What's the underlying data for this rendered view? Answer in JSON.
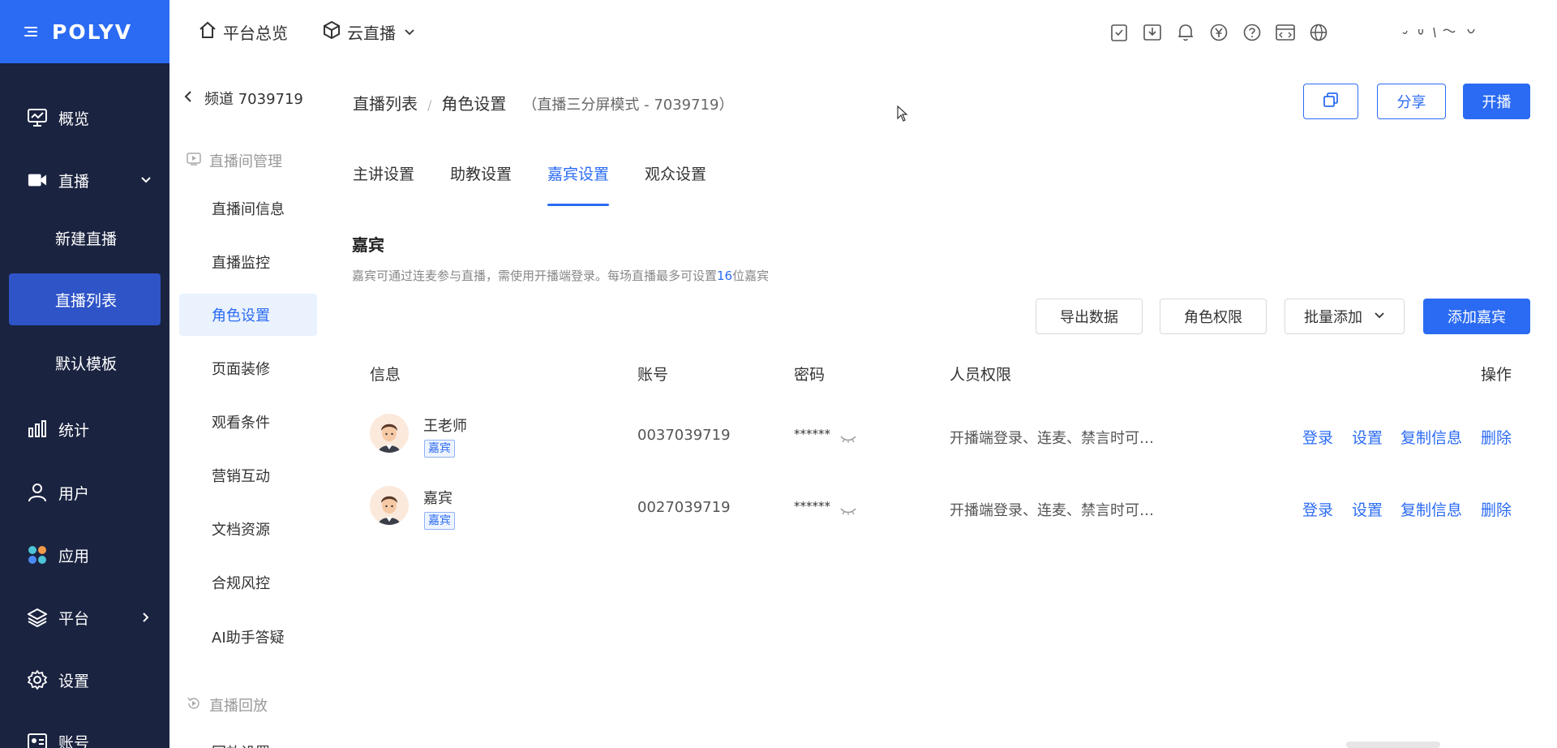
{
  "brand": {
    "logo": "POLYV"
  },
  "leftnav": {
    "items": [
      {
        "label": "概览",
        "icon": "monitor-chart-icon"
      },
      {
        "label": "直播",
        "icon": "video-camera-icon"
      },
      {
        "label": "统计",
        "icon": "bar-chart-icon"
      },
      {
        "label": "用户",
        "icon": "user-icon"
      },
      {
        "label": "应用",
        "icon": "apps-grid-icon"
      },
      {
        "label": "平台",
        "icon": "layers-icon"
      },
      {
        "label": "设置",
        "icon": "gear-icon"
      },
      {
        "label": "账号",
        "icon": "id-card-icon"
      }
    ],
    "live_sub": [
      "新建直播",
      "直播列表",
      "默认模板"
    ]
  },
  "topbar": {
    "overview": "平台总览",
    "product": "云直播"
  },
  "channel": {
    "back_label": "频道 7039719"
  },
  "sidecol": {
    "group1": "直播间管理",
    "items": [
      "直播间信息",
      "直播监控",
      "角色设置",
      "页面装修",
      "观看条件",
      "营销互动",
      "文档资源",
      "合规风控",
      "AI助手答疑"
    ],
    "group2": "直播回放",
    "partial": "回放设置"
  },
  "breadcrumb": {
    "parent": "直播列表",
    "current": "角色设置",
    "mode": "（直播三分屏模式 - 7039719）"
  },
  "header_buttons": {
    "share": "分享",
    "start": "开播"
  },
  "tabs": [
    "主讲设置",
    "助教设置",
    "嘉宾设置",
    "观众设置"
  ],
  "section": {
    "title": "嘉宾",
    "desc_prefix": "嘉宾可通过连麦参与直播，需使用开播端登录。每场直播最多可设置",
    "desc_count": "16",
    "desc_suffix": "位嘉宾"
  },
  "actions": {
    "export": "导出数据",
    "role_perm": "角色权限",
    "batch_add": "批量添加",
    "add_guest": "添加嘉宾"
  },
  "table": {
    "headers": {
      "info": "信息",
      "account": "账号",
      "password": "密码",
      "perm": "人员权限",
      "ops": "操作"
    },
    "rows": [
      {
        "name": "王老师",
        "tag": "嘉宾",
        "account": "0037039719",
        "password": "******",
        "perm": "开播端登录、连麦、禁言时可…"
      },
      {
        "name": "嘉宾",
        "tag": "嘉宾",
        "account": "0027039719",
        "password": "******",
        "perm": "开播端登录、连麦、禁言时可…"
      }
    ],
    "ops": {
      "login": "登录",
      "settings": "设置",
      "copy": "复制信息",
      "delete": "删除"
    }
  },
  "colors": {
    "primary": "#2b6bf3",
    "nav_bg": "#1a2340",
    "nav_active": "#2e54c8"
  }
}
